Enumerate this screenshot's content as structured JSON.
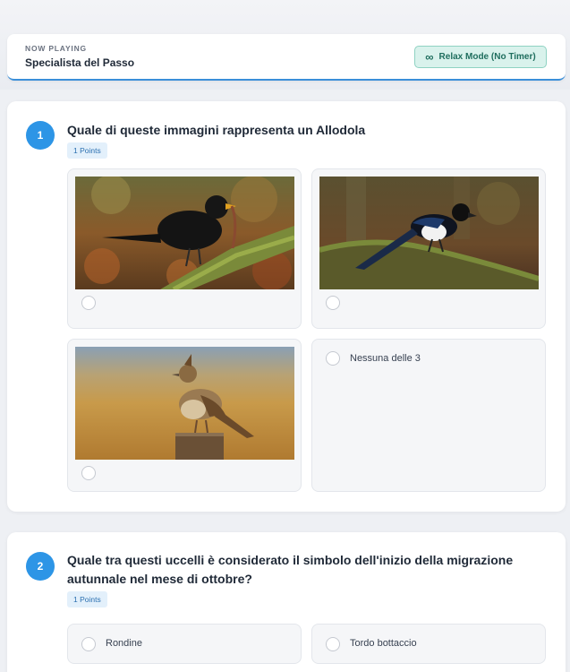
{
  "header": {
    "now_playing": "NOW PLAYING",
    "quiz_title": "Specialista del Passo",
    "mode_icon": "infinity-icon",
    "mode_label": "Relax Mode (No Timer)"
  },
  "questions": [
    {
      "number": "1",
      "text": "Quale di queste immagini rappresenta un Allodola",
      "points": "1 Points",
      "options": [
        {
          "type": "image",
          "image": "blackbird-photo",
          "label": ""
        },
        {
          "type": "image",
          "image": "magpie-photo",
          "label": ""
        },
        {
          "type": "image",
          "image": "skylark-photo",
          "label": ""
        },
        {
          "type": "text",
          "label": "Nessuna delle 3"
        }
      ]
    },
    {
      "number": "2",
      "text_line1": "Quale tra questi uccelli è considerato il simbolo dell'inizio della migrazione",
      "text_line2": "autunnale nel mese di ottobre?",
      "points": "1 Points",
      "options": [
        {
          "type": "text",
          "label": "Rondine"
        },
        {
          "type": "text",
          "label": "Tordo bottaccio"
        }
      ]
    }
  ],
  "colors": {
    "accent": "#2d95e6",
    "mode_badge_bg": "#d9f2ec",
    "mode_badge_text": "#1f6e5e"
  }
}
